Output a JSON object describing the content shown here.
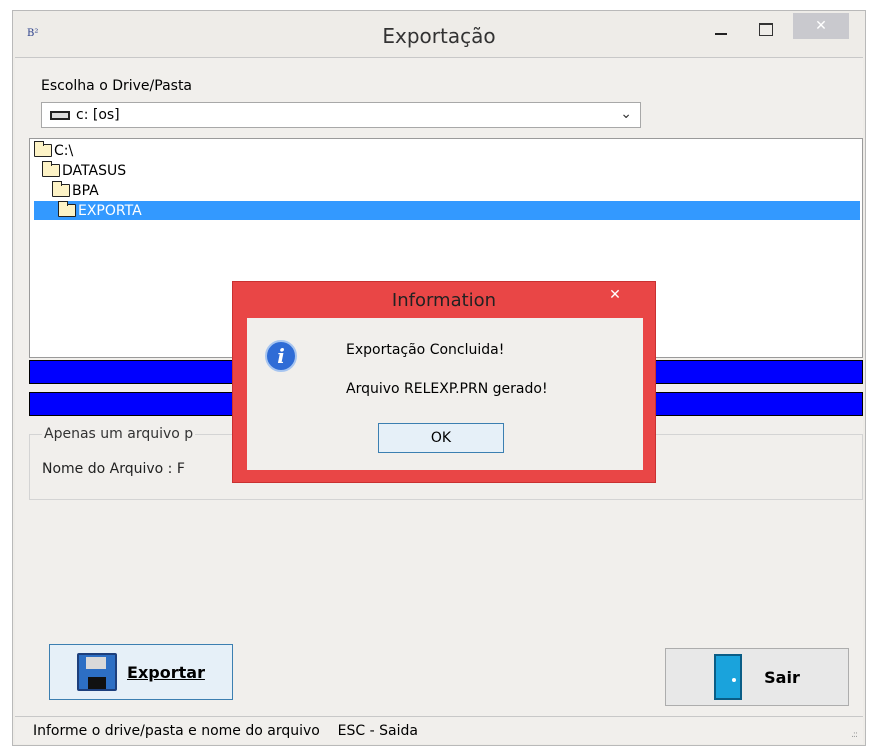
{
  "window": {
    "app_icon_text": "B²",
    "title": "Exportação",
    "close_glyph": "✕"
  },
  "drive": {
    "label": "Escolha o Drive/Pasta",
    "selected": "c: [os]",
    "icon": "drive-icon"
  },
  "tree": {
    "items": [
      {
        "label": "C:\\",
        "icon": "folder-open-icon"
      },
      {
        "label": "DATASUS",
        "icon": "folder-open-icon"
      },
      {
        "label": "BPA",
        "icon": "folder-open-icon"
      },
      {
        "label": "EXPORTA",
        "icon": "folder-open-icon",
        "selected": true
      }
    ]
  },
  "progress": {
    "bar1_fraction": 1.0,
    "bar2_fraction": 1.0,
    "color": "#0000ff"
  },
  "group": {
    "legend": "Apenas um arquivo p",
    "filename_label": "Nome do Arquivo : F"
  },
  "buttons": {
    "export_label": "Exportar",
    "exit_label": "Sair"
  },
  "status": {
    "text": "Informe o drive/pasta e nome do arquivo    ESC - Saida",
    "grip": ".::"
  },
  "dialog": {
    "title": "Information",
    "close_glyph": "✕",
    "icon_letter": "i",
    "message1": "Exportação Concluida!",
    "message2": "Arquivo RELEXP.PRN gerado!",
    "ok_label": "OK",
    "accent": "#e94646"
  },
  "colors": {
    "selection": "#3399ff",
    "progress": "#0000ff"
  }
}
